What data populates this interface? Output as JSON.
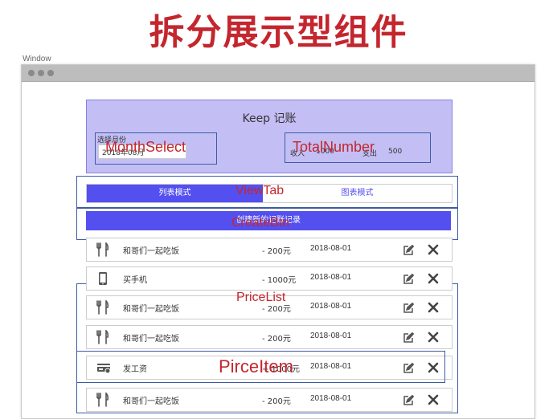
{
  "slide_title": "拆分展示型组件",
  "window": {
    "label": "Window"
  },
  "header": {
    "app_title": "Keep 记账",
    "month_label": "选择月份",
    "month_value": "2018年08月",
    "income_label": "收入",
    "income_value": "1000",
    "expense_label": "支出",
    "expense_value": "500"
  },
  "view_tab": {
    "list_mode": "列表模式",
    "chart_mode": "图表模式"
  },
  "create_button": {
    "label": "创建新的记账记录"
  },
  "items": [
    {
      "icon": "food-icon",
      "name": "和哥们一起吃饭",
      "amount": "- 200元",
      "date": "2018-08-01"
    },
    {
      "icon": "phone-icon",
      "name": "买手机",
      "amount": "- 1000元",
      "date": "2018-08-01"
    },
    {
      "icon": "food-icon",
      "name": "和哥们一起吃饭",
      "amount": "- 200元",
      "date": "2018-08-01"
    },
    {
      "icon": "food-icon",
      "name": "和哥们一起吃饭",
      "amount": "- 200元",
      "date": "2018-08-01"
    },
    {
      "icon": "salary-icon",
      "name": "发工资",
      "amount": "+ 1000元",
      "date": "2018-08-01"
    },
    {
      "icon": "food-icon",
      "name": "和哥们一起吃饭",
      "amount": "- 200元",
      "date": "2018-08-01"
    }
  ],
  "component_labels": {
    "month_select": "MonthSelect",
    "total_number": "TotalNumber",
    "view_tab": "ViewTab",
    "create_btn": "CreateBtn",
    "price_list": "PriceList",
    "price_item": "PirceItem"
  },
  "colors": {
    "title_red": "#c4262e",
    "primary": "#5450f0",
    "header_bg": "#c3bff5",
    "outline_blue": "#3d5ca3"
  }
}
